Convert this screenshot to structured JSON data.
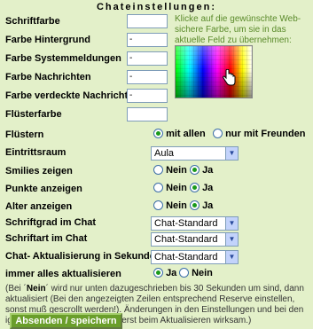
{
  "title": "Chateinstellungen:",
  "hint": "Klicke auf die gewünschte Web-sichere Farbe, um sie in das aktuelle Feld zu übernehmen:",
  "color_fields": [
    {
      "label": "Schriftfarbe",
      "value": ""
    },
    {
      "label": "Farbe Hintergrund",
      "value": "-"
    },
    {
      "label": "Farbe Systemmeldungen",
      "value": "-"
    },
    {
      "label": "Farbe Nachrichten",
      "value": "-"
    },
    {
      "label": "Farbe verdeckte Nachricht",
      "value": "-"
    },
    {
      "label": "Flüsterfarbe",
      "value": ""
    }
  ],
  "fluestern": {
    "label": "Flüstern",
    "opt1": "mit allen",
    "opt2": "nur mit Freunden",
    "selected": "mit allen"
  },
  "eintrittsraum": {
    "label": "Eintrittsraum",
    "value": "Aula"
  },
  "smilies": {
    "label": "Smilies zeigen",
    "no": "Nein",
    "yes": "Ja",
    "selected": "Ja"
  },
  "punkte": {
    "label": "Punkte anzeigen",
    "no": "Nein",
    "yes": "Ja",
    "selected": "Ja"
  },
  "alter": {
    "label": "Alter anzeigen",
    "no": "Nein",
    "yes": "Ja",
    "selected": "Ja"
  },
  "schriftgrad": {
    "label": "Schriftgrad im Chat",
    "value": "Chat-Standard"
  },
  "schriftart": {
    "label": "Schriftart im Chat",
    "value": "Chat-Standard"
  },
  "aktualisierung": {
    "label": "Chat- Aktualisierung in Sekunden",
    "value": "Chat-Standard"
  },
  "immer": {
    "label": "immer alles aktualisieren",
    "yes": "Ja",
    "no": "Nein",
    "selected": "Ja"
  },
  "note": {
    "prefix": "(Bei ´",
    "bold": "Nein",
    "rest": "´ wird nur unten dazugeschrieben bis 30 Sekunden um sind, dann aktualisiert (Bei den angezeigten Zeilen entsprechend Reserve einstellen, sonst muß gescrollt werden!). Änderungen in den Einstellungen und bei den ignorierten Personen werden erst beim Aktualisieren wirksam.)"
  },
  "submit_label": "Absenden / speichern",
  "colors": {
    "background": "#e3f0c9",
    "hint_text": "#5a8a2a",
    "button": "#6a9e2a",
    "radio_on": "#1a9a1a"
  }
}
